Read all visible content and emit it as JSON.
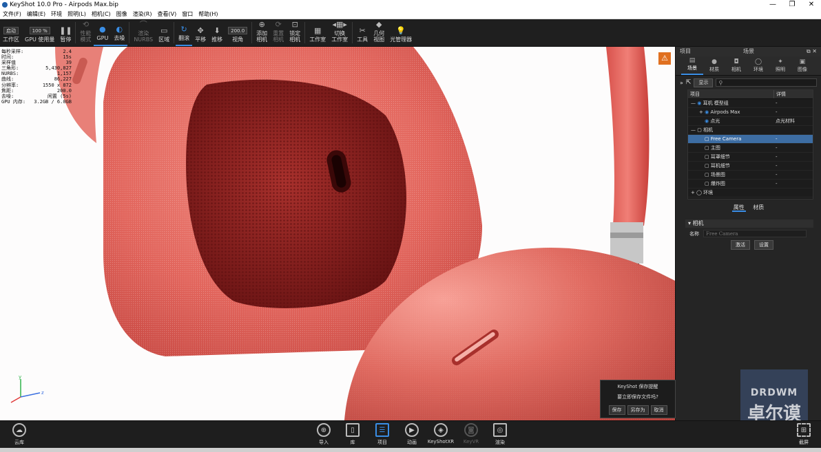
{
  "window": {
    "title": "KeyShot 10.0 Pro  -  Airpods Max.bip",
    "minimize": "—",
    "maximize": "❐",
    "close": "✕"
  },
  "menu": [
    "文件(F)",
    "编辑(E)",
    "环境",
    "照明(L)",
    "相机(C)",
    "图像",
    "渲染(R)",
    "查看(V)",
    "窗口",
    "帮助(H)"
  ],
  "toolbar": {
    "workspace_select": "启动",
    "zoom_value": "100 %",
    "fov_value": "200.0",
    "items": [
      {
        "label": "工作区",
        "icon": "workspace-icon",
        "state": "normal"
      },
      {
        "label": "GPU 使用量",
        "icon": "gpu-usage-icon",
        "state": "normal"
      },
      {
        "label": "暂停",
        "icon": "pause-icon",
        "state": "normal"
      },
      {
        "label": "性能\n模式",
        "icon": "performance-icon",
        "state": "dim"
      },
      {
        "label": "GPU",
        "icon": "gpu-icon",
        "state": "active"
      },
      {
        "label": "去噪",
        "icon": "denoise-icon",
        "state": "active"
      },
      {
        "label": "渲染\nNURBS",
        "icon": "nurbs-icon",
        "state": "dim"
      },
      {
        "label": "区域",
        "icon": "region-icon",
        "state": "normal"
      },
      {
        "label": "翻滚",
        "icon": "tumble-icon",
        "state": "active"
      },
      {
        "label": "平移",
        "icon": "pan-icon",
        "state": "normal"
      },
      {
        "label": "推移",
        "icon": "dolly-icon",
        "state": "normal"
      },
      {
        "label": "视角",
        "icon": "fov-icon",
        "state": "normal"
      },
      {
        "label": "添加\n相机",
        "icon": "add-camera-icon",
        "state": "normal"
      },
      {
        "label": "重置\n相机",
        "icon": "reset-camera-icon",
        "state": "dim"
      },
      {
        "label": "锁定\n相机",
        "icon": "lock-camera-icon",
        "state": "normal"
      },
      {
        "label": "工作室",
        "icon": "studio-icon",
        "state": "normal"
      },
      {
        "label": "切换\n工作室",
        "icon": "switch-studio-icon",
        "state": "normal"
      },
      {
        "label": "工具",
        "icon": "tools-icon",
        "state": "normal"
      },
      {
        "label": "几何\n视图",
        "icon": "geometry-view-icon",
        "state": "normal"
      },
      {
        "label": "光管理器",
        "icon": "light-manager-icon",
        "state": "normal"
      }
    ]
  },
  "stats": [
    {
      "k": "每秒采样:",
      "v": "2.4"
    },
    {
      "k": "时间:",
      "v": "15s"
    },
    {
      "k": "采样值",
      "v": "39"
    },
    {
      "k": "三角形:",
      "v": "5,430,827"
    },
    {
      "k": "NURBS:",
      "v": "1,157"
    },
    {
      "k": "曲线:",
      "v": "86,227"
    },
    {
      "k": "分辨率:",
      "v": "1550 x 872"
    },
    {
      "k": "焦距:",
      "v": "200.0"
    },
    {
      "k": "去噪:",
      "v": "闲置 (5s)"
    },
    {
      "k": "GPU 内存:",
      "v": "3.2GB / 6.0GB"
    }
  ],
  "axis": {
    "y": "y",
    "z": "z"
  },
  "save_dialog": {
    "title": "KeyShot 保存提醒",
    "question": "要立即保存文件吗?",
    "save": "保存",
    "save_as": "另存为",
    "cancel": "取消"
  },
  "watermark": {
    "line1": "DRDWM",
    "line2": "卓尔谟"
  },
  "panel": {
    "left_title": "项目",
    "title": "场景",
    "tabs": [
      {
        "label": "场景",
        "icon": "scene-icon",
        "active": true
      },
      {
        "label": "材质",
        "icon": "material-icon",
        "active": false
      },
      {
        "label": "相机",
        "icon": "camera-icon",
        "active": false
      },
      {
        "label": "环境",
        "icon": "environment-icon",
        "active": false
      },
      {
        "label": "照明",
        "icon": "lighting-icon",
        "active": false
      },
      {
        "label": "图像",
        "icon": "image-icon",
        "active": false
      }
    ],
    "show_button": "显示",
    "tree_headers": {
      "name": "项目",
      "detail": "详情"
    },
    "tree": [
      {
        "name": "耳机 模型组",
        "detail": "-",
        "indent": 0,
        "eye": true,
        "selected": false
      },
      {
        "name": "Airpods Max",
        "detail": "-",
        "indent": 2,
        "eye": true,
        "selected": false
      },
      {
        "name": "点光",
        "detail": "点光材料",
        "indent": 2,
        "eye": true,
        "selected": false
      },
      {
        "name": "相机",
        "detail": "",
        "indent": 0,
        "eye": false,
        "selected": false
      },
      {
        "name": "Free Camera",
        "detail": "-",
        "indent": 2,
        "eye": false,
        "selected": true
      },
      {
        "name": "主图",
        "detail": "-",
        "indent": 2,
        "eye": false,
        "selected": false
      },
      {
        "name": "耳罩细节",
        "detail": "-",
        "indent": 2,
        "eye": false,
        "selected": false
      },
      {
        "name": "耳机细节",
        "detail": "-",
        "indent": 2,
        "eye": false,
        "selected": false
      },
      {
        "name": "场景图",
        "detail": "-",
        "indent": 2,
        "eye": false,
        "selected": false
      },
      {
        "name": "爆炸图",
        "detail": "-",
        "indent": 2,
        "eye": false,
        "selected": false
      },
      {
        "name": "环境",
        "detail": "",
        "indent": 0,
        "eye": false,
        "selected": false
      }
    ],
    "sub_tabs": [
      {
        "label": "属性",
        "active": true
      },
      {
        "label": "材质",
        "active": false
      }
    ],
    "section_title": "相机",
    "name_label": "名称",
    "name_value": "Free Camera",
    "activate": "激活",
    "settings": "设置"
  },
  "bottom": {
    "cloud": "云库",
    "fullscreen": "截屏",
    "items": [
      {
        "label": "导入",
        "icon": "import-icon",
        "state": "normal"
      },
      {
        "label": "库",
        "icon": "library-icon",
        "state": "normal"
      },
      {
        "label": "项目",
        "icon": "project-icon",
        "state": "active"
      },
      {
        "label": "动画",
        "icon": "animation-icon",
        "state": "normal"
      },
      {
        "label": "KeyShotXR",
        "icon": "keyshotxr-icon",
        "state": "normal"
      },
      {
        "label": "KeyVR",
        "icon": "keyvr-icon",
        "state": "dim"
      },
      {
        "label": "渲染",
        "icon": "render-icon",
        "state": "normal"
      }
    ]
  }
}
